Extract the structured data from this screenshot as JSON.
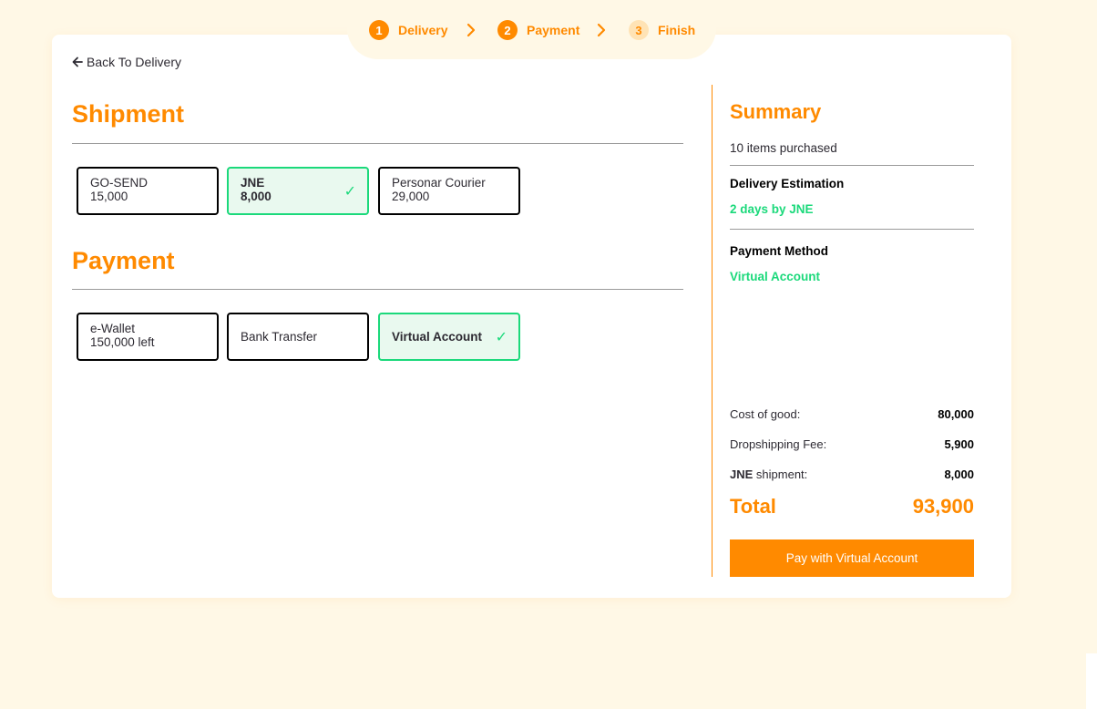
{
  "stepper": {
    "steps": [
      {
        "number": "1",
        "label": "Delivery"
      },
      {
        "number": "2",
        "label": "Payment"
      },
      {
        "number": "3",
        "label": "Finish"
      }
    ]
  },
  "back_link": "Back To Delivery",
  "shipment": {
    "title": "Shipment",
    "options": [
      {
        "name": "GO-SEND",
        "price": "15,000",
        "selected": false
      },
      {
        "name": "JNE",
        "price": "8,000",
        "selected": true
      },
      {
        "name": "Personar Courier",
        "price": "29,000",
        "selected": false
      }
    ]
  },
  "payment": {
    "title": "Payment",
    "options": [
      {
        "name": "e-Wallet",
        "detail": "150,000 left",
        "selected": false
      },
      {
        "name": "Bank Transfer",
        "selected": false
      },
      {
        "name": "Virtual Account",
        "selected": true
      }
    ]
  },
  "summary": {
    "title": "Summary",
    "items_purchased": "10 items purchased",
    "delivery_label": "Delivery Estimation",
    "delivery_value": "2 days by JNE",
    "payment_label": "Payment Method",
    "payment_value": "Virtual Account",
    "cost_of_good_label": "Cost of good:",
    "cost_of_good_value": "80,000",
    "dropshipping_label": "Dropshipping Fee:",
    "dropshipping_value": "5,900",
    "shipment_courier": "JNE",
    "shipment_suffix": " shipment:",
    "shipment_value": "8,000",
    "total_label": "Total",
    "total_value": "93,900",
    "pay_button": "Pay with Virtual Account"
  },
  "colors": {
    "accent": "#ff8a00",
    "success": "#1bd97b",
    "background": "#fff8e6"
  },
  "icons": {
    "back": "arrow-left-icon",
    "step_separator": "chevron-right-icon",
    "selected": "check-icon"
  }
}
